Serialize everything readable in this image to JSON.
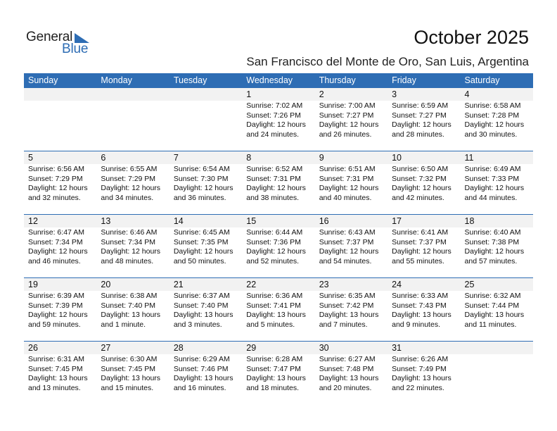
{
  "logo": {
    "word1": "General",
    "word2": "Blue"
  },
  "header": {
    "title": "October 2025",
    "location": "San Francisco del Monte de Oro, San Luis, Argentina"
  },
  "colors": {
    "accent": "#2e6db4",
    "day_number_bg": "#f2f2f2"
  },
  "weekdays": [
    "Sunday",
    "Monday",
    "Tuesday",
    "Wednesday",
    "Thursday",
    "Friday",
    "Saturday"
  ],
  "weeks": [
    [
      null,
      null,
      null,
      {
        "day": "1",
        "sunrise": "Sunrise: 7:02 AM",
        "sunset": "Sunset: 7:26 PM",
        "daylight1": "Daylight: 12 hours",
        "daylight2": "and 24 minutes."
      },
      {
        "day": "2",
        "sunrise": "Sunrise: 7:00 AM",
        "sunset": "Sunset: 7:27 PM",
        "daylight1": "Daylight: 12 hours",
        "daylight2": "and 26 minutes."
      },
      {
        "day": "3",
        "sunrise": "Sunrise: 6:59 AM",
        "sunset": "Sunset: 7:27 PM",
        "daylight1": "Daylight: 12 hours",
        "daylight2": "and 28 minutes."
      },
      {
        "day": "4",
        "sunrise": "Sunrise: 6:58 AM",
        "sunset": "Sunset: 7:28 PM",
        "daylight1": "Daylight: 12 hours",
        "daylight2": "and 30 minutes."
      }
    ],
    [
      {
        "day": "5",
        "sunrise": "Sunrise: 6:56 AM",
        "sunset": "Sunset: 7:29 PM",
        "daylight1": "Daylight: 12 hours",
        "daylight2": "and 32 minutes."
      },
      {
        "day": "6",
        "sunrise": "Sunrise: 6:55 AM",
        "sunset": "Sunset: 7:29 PM",
        "daylight1": "Daylight: 12 hours",
        "daylight2": "and 34 minutes."
      },
      {
        "day": "7",
        "sunrise": "Sunrise: 6:54 AM",
        "sunset": "Sunset: 7:30 PM",
        "daylight1": "Daylight: 12 hours",
        "daylight2": "and 36 minutes."
      },
      {
        "day": "8",
        "sunrise": "Sunrise: 6:52 AM",
        "sunset": "Sunset: 7:31 PM",
        "daylight1": "Daylight: 12 hours",
        "daylight2": "and 38 minutes."
      },
      {
        "day": "9",
        "sunrise": "Sunrise: 6:51 AM",
        "sunset": "Sunset: 7:31 PM",
        "daylight1": "Daylight: 12 hours",
        "daylight2": "and 40 minutes."
      },
      {
        "day": "10",
        "sunrise": "Sunrise: 6:50 AM",
        "sunset": "Sunset: 7:32 PM",
        "daylight1": "Daylight: 12 hours",
        "daylight2": "and 42 minutes."
      },
      {
        "day": "11",
        "sunrise": "Sunrise: 6:49 AM",
        "sunset": "Sunset: 7:33 PM",
        "daylight1": "Daylight: 12 hours",
        "daylight2": "and 44 minutes."
      }
    ],
    [
      {
        "day": "12",
        "sunrise": "Sunrise: 6:47 AM",
        "sunset": "Sunset: 7:34 PM",
        "daylight1": "Daylight: 12 hours",
        "daylight2": "and 46 minutes."
      },
      {
        "day": "13",
        "sunrise": "Sunrise: 6:46 AM",
        "sunset": "Sunset: 7:34 PM",
        "daylight1": "Daylight: 12 hours",
        "daylight2": "and 48 minutes."
      },
      {
        "day": "14",
        "sunrise": "Sunrise: 6:45 AM",
        "sunset": "Sunset: 7:35 PM",
        "daylight1": "Daylight: 12 hours",
        "daylight2": "and 50 minutes."
      },
      {
        "day": "15",
        "sunrise": "Sunrise: 6:44 AM",
        "sunset": "Sunset: 7:36 PM",
        "daylight1": "Daylight: 12 hours",
        "daylight2": "and 52 minutes."
      },
      {
        "day": "16",
        "sunrise": "Sunrise: 6:43 AM",
        "sunset": "Sunset: 7:37 PM",
        "daylight1": "Daylight: 12 hours",
        "daylight2": "and 54 minutes."
      },
      {
        "day": "17",
        "sunrise": "Sunrise: 6:41 AM",
        "sunset": "Sunset: 7:37 PM",
        "daylight1": "Daylight: 12 hours",
        "daylight2": "and 55 minutes."
      },
      {
        "day": "18",
        "sunrise": "Sunrise: 6:40 AM",
        "sunset": "Sunset: 7:38 PM",
        "daylight1": "Daylight: 12 hours",
        "daylight2": "and 57 minutes."
      }
    ],
    [
      {
        "day": "19",
        "sunrise": "Sunrise: 6:39 AM",
        "sunset": "Sunset: 7:39 PM",
        "daylight1": "Daylight: 12 hours",
        "daylight2": "and 59 minutes."
      },
      {
        "day": "20",
        "sunrise": "Sunrise: 6:38 AM",
        "sunset": "Sunset: 7:40 PM",
        "daylight1": "Daylight: 13 hours",
        "daylight2": "and 1 minute."
      },
      {
        "day": "21",
        "sunrise": "Sunrise: 6:37 AM",
        "sunset": "Sunset: 7:40 PM",
        "daylight1": "Daylight: 13 hours",
        "daylight2": "and 3 minutes."
      },
      {
        "day": "22",
        "sunrise": "Sunrise: 6:36 AM",
        "sunset": "Sunset: 7:41 PM",
        "daylight1": "Daylight: 13 hours",
        "daylight2": "and 5 minutes."
      },
      {
        "day": "23",
        "sunrise": "Sunrise: 6:35 AM",
        "sunset": "Sunset: 7:42 PM",
        "daylight1": "Daylight: 13 hours",
        "daylight2": "and 7 minutes."
      },
      {
        "day": "24",
        "sunrise": "Sunrise: 6:33 AM",
        "sunset": "Sunset: 7:43 PM",
        "daylight1": "Daylight: 13 hours",
        "daylight2": "and 9 minutes."
      },
      {
        "day": "25",
        "sunrise": "Sunrise: 6:32 AM",
        "sunset": "Sunset: 7:44 PM",
        "daylight1": "Daylight: 13 hours",
        "daylight2": "and 11 minutes."
      }
    ],
    [
      {
        "day": "26",
        "sunrise": "Sunrise: 6:31 AM",
        "sunset": "Sunset: 7:45 PM",
        "daylight1": "Daylight: 13 hours",
        "daylight2": "and 13 minutes."
      },
      {
        "day": "27",
        "sunrise": "Sunrise: 6:30 AM",
        "sunset": "Sunset: 7:45 PM",
        "daylight1": "Daylight: 13 hours",
        "daylight2": "and 15 minutes."
      },
      {
        "day": "28",
        "sunrise": "Sunrise: 6:29 AM",
        "sunset": "Sunset: 7:46 PM",
        "daylight1": "Daylight: 13 hours",
        "daylight2": "and 16 minutes."
      },
      {
        "day": "29",
        "sunrise": "Sunrise: 6:28 AM",
        "sunset": "Sunset: 7:47 PM",
        "daylight1": "Daylight: 13 hours",
        "daylight2": "and 18 minutes."
      },
      {
        "day": "30",
        "sunrise": "Sunrise: 6:27 AM",
        "sunset": "Sunset: 7:48 PM",
        "daylight1": "Daylight: 13 hours",
        "daylight2": "and 20 minutes."
      },
      {
        "day": "31",
        "sunrise": "Sunrise: 6:26 AM",
        "sunset": "Sunset: 7:49 PM",
        "daylight1": "Daylight: 13 hours",
        "daylight2": "and 22 minutes."
      },
      null
    ]
  ]
}
